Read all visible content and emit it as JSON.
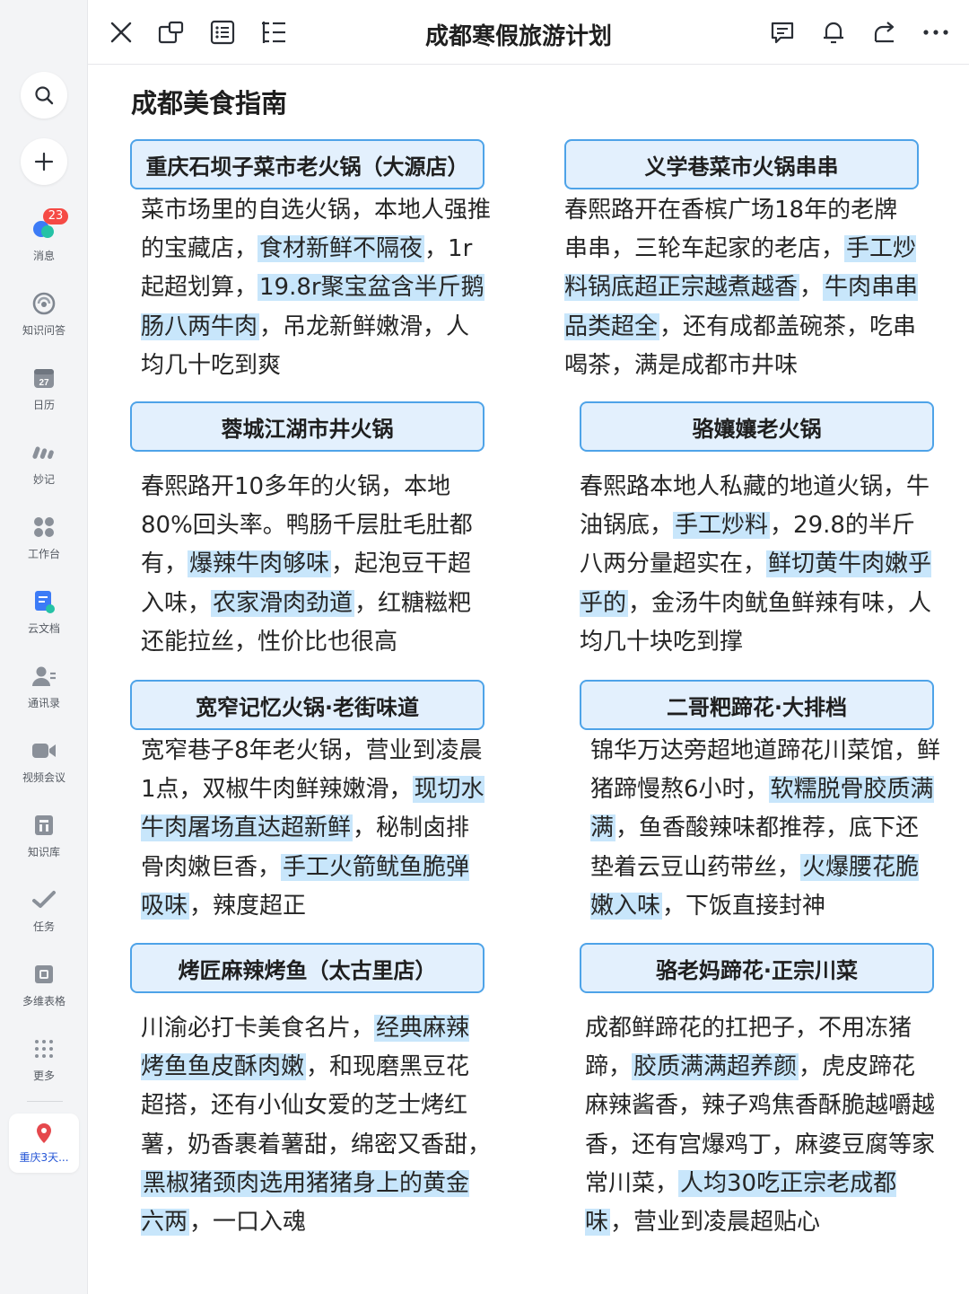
{
  "sidebar": {
    "items": [
      {
        "label": "消息",
        "icon": "message-icon",
        "badge": "23"
      },
      {
        "label": "知识问答",
        "icon": "knowledge-qa-icon"
      },
      {
        "label": "日历",
        "icon": "calendar-icon",
        "icon_text": "27"
      },
      {
        "label": "妙记",
        "icon": "minutes-icon"
      },
      {
        "label": "工作台",
        "icon": "workplace-icon"
      },
      {
        "label": "云文档",
        "icon": "cloud-docs-icon"
      },
      {
        "label": "通讯录",
        "icon": "contacts-icon"
      },
      {
        "label": "视频会议",
        "icon": "video-meeting-icon"
      },
      {
        "label": "知识库",
        "icon": "wiki-icon"
      },
      {
        "label": "任务",
        "icon": "tasks-icon"
      },
      {
        "label": "多维表格",
        "icon": "base-table-icon"
      },
      {
        "label": "更多",
        "icon": "more-grid-icon"
      }
    ],
    "recent": {
      "label": "重庆3天...",
      "icon": "location-pin-icon"
    }
  },
  "topbar": {
    "title": "成都寒假旅游计划",
    "left_icons": [
      "close-icon",
      "new-window-icon",
      "outline-icon",
      "table-of-contents-icon"
    ],
    "right_icons": [
      "comment-icon",
      "notification-bell-icon",
      "share-icon",
      "more-icon"
    ]
  },
  "content": {
    "heading": "成都美食指南",
    "cards": [
      {
        "title": "重庆石坝子菜市老火锅（大源店）",
        "body": [
          {
            "t": "菜市场里的自选火锅，本地人强推的宝藏店，"
          },
          {
            "t": "食材新鲜不隔夜",
            "hl": true
          },
          {
            "t": "，1r起超划算，"
          },
          {
            "t": "19.8r聚宝盆含半斤鹅肠八两牛肉",
            "hl": true
          },
          {
            "t": "，吊龙新鲜嫩滑，人均几十吃到爽"
          }
        ]
      },
      {
        "title": "义学巷菜市火锅串串",
        "body": [
          {
            "t": "春熙路开在香槟广场18年的老牌串串，三轮车起家的老店，"
          },
          {
            "t": "手工炒料锅底超正宗越煮越香",
            "hl": true
          },
          {
            "t": "，"
          },
          {
            "t": "牛肉串串品类超全",
            "hl": true
          },
          {
            "t": "，还有成都盖碗茶，吃串喝茶，满是成都市井味"
          }
        ]
      },
      {
        "title": "蓉城江湖市井火锅",
        "body": [
          {
            "t": "春熙路开10多年的火锅，本地80%回头率。鸭肠千层肚毛肚都有，"
          },
          {
            "t": "爆辣牛肉够味",
            "hl": true
          },
          {
            "t": "，起泡豆干超入味，"
          },
          {
            "t": "农家滑肉劲道",
            "hl": true
          },
          {
            "t": "，红糖糍粑还能拉丝，性价比也很高"
          }
        ]
      },
      {
        "title": "骆孃孃老火锅",
        "body": [
          {
            "t": "春熙路本地人私藏的地道火锅，牛油锅底，"
          },
          {
            "t": "手工炒料",
            "hl": true
          },
          {
            "t": "，29.8的半斤八两分量超实在，"
          },
          {
            "t": "鲜切黄牛肉嫩乎乎的",
            "hl": true
          },
          {
            "t": "，金汤牛肉鱿鱼鲜辣有味，人均几十块吃到撑"
          }
        ]
      },
      {
        "title": "宽窄记忆火锅·老街味道",
        "body": [
          {
            "t": "宽窄巷子8年老火锅，营业到凌晨1点，双椒牛肉鲜辣嫩滑，"
          },
          {
            "t": "现切水牛肉屠场直达超新鲜",
            "hl": true
          },
          {
            "t": "，秘制卤排骨肉嫩巨香，"
          },
          {
            "t": "手工火箭鱿鱼脆弹吸味",
            "hl": true
          },
          {
            "t": "，辣度超正"
          }
        ]
      },
      {
        "title": "二哥粑蹄花·大排档",
        "body": [
          {
            "t": "锦华万达旁超地道蹄花川菜馆，鲜猪蹄慢熬6小时，"
          },
          {
            "t": "软糯脱骨胶质满满",
            "hl": true
          },
          {
            "t": "，鱼香酸辣味都推荐，底下还垫着云豆山药带丝，"
          },
          {
            "t": "火爆腰花脆嫩入味",
            "hl": true
          },
          {
            "t": "，下饭直接封神"
          }
        ]
      },
      {
        "title": "烤匠麻辣烤鱼（太古里店）",
        "body": [
          {
            "t": "川渝必打卡美食名片，"
          },
          {
            "t": "经典麻辣烤鱼鱼皮酥肉嫩",
            "hl": true
          },
          {
            "t": "，和现磨黑豆花超搭，还有小仙女爱的芝士烤红薯，奶香裹着薯甜，绵密又香甜，"
          },
          {
            "t": "黑椒猪颈肉选用猪猪身上的黄金六两",
            "hl": true
          },
          {
            "t": "，一口入魂"
          }
        ]
      },
      {
        "title": "骆老妈蹄花·正宗川菜",
        "body": [
          {
            "t": "成都鲜蹄花的扛把子，不用冻猪蹄，"
          },
          {
            "t": "胶质满满超养颜",
            "hl": true
          },
          {
            "t": "，虎皮蹄花麻辣酱香，辣子鸡焦香酥脆越嚼越香，还有宫爆鸡丁，麻婆豆腐等家常川菜，"
          },
          {
            "t": "人均30吃正宗老成都味",
            "hl": true
          },
          {
            "t": "，营业到凌晨超贴心"
          }
        ]
      }
    ]
  },
  "colors": {
    "card_border": "#4ea3e8",
    "card_fill": "#e3f0fd",
    "highlight": "#c8e6fb",
    "badge": "#f54a45",
    "sidebar_bg": "#f3f4f6"
  }
}
